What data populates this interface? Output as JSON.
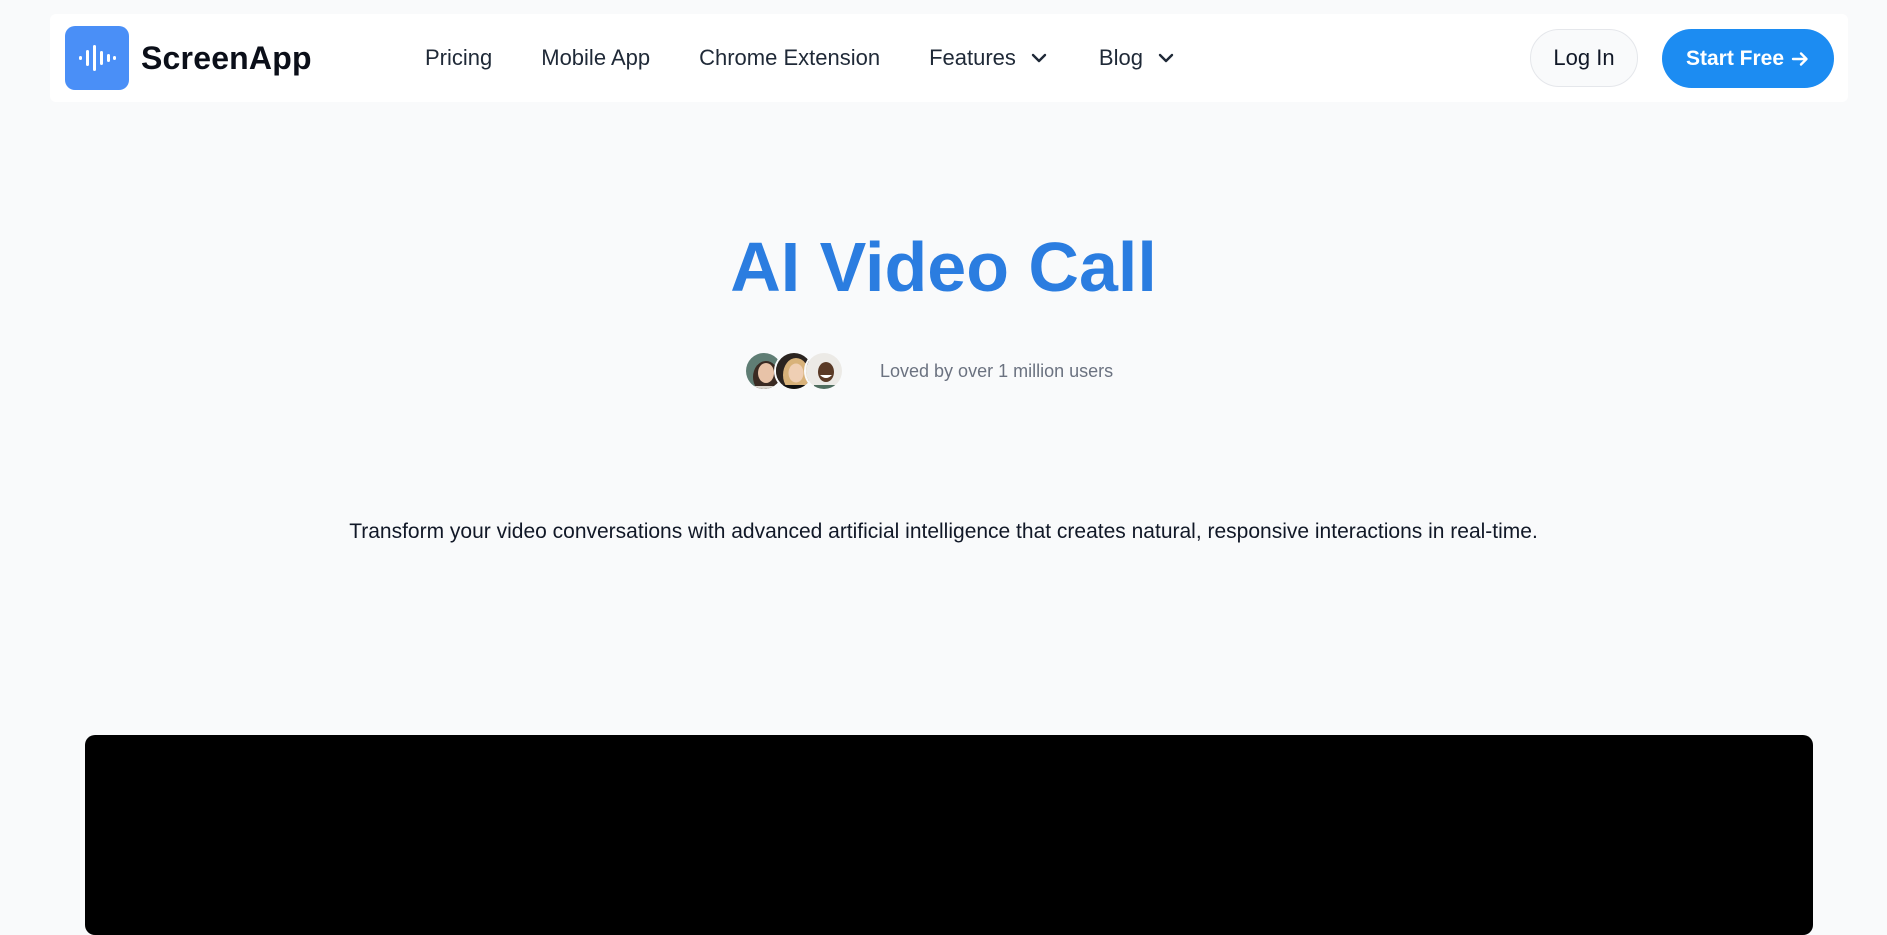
{
  "nav": {
    "brand": "ScreenApp",
    "logo_icon": "waveform-icon",
    "links": [
      {
        "label": "Pricing"
      },
      {
        "label": "Mobile App"
      },
      {
        "label": "Chrome Extension"
      },
      {
        "label": "Features",
        "icon": "chevron-down-icon"
      },
      {
        "label": "Blog",
        "icon": "chevron-down-icon"
      }
    ],
    "login_label": "Log In",
    "start_label": "Start Free",
    "start_icon": "arrow-right-icon"
  },
  "hero": {
    "title": "AI Video Call",
    "proof_text": "Loved by over 1 million users",
    "description": "Transform your video conversations with advanced artificial intelligence that creates natural, responsive interactions in real-time."
  },
  "colors": {
    "accent": "#1c8cf2",
    "title": "#2b7de0",
    "logo": "#4a8ff7",
    "background": "#f9fafb",
    "video": "#000000"
  }
}
